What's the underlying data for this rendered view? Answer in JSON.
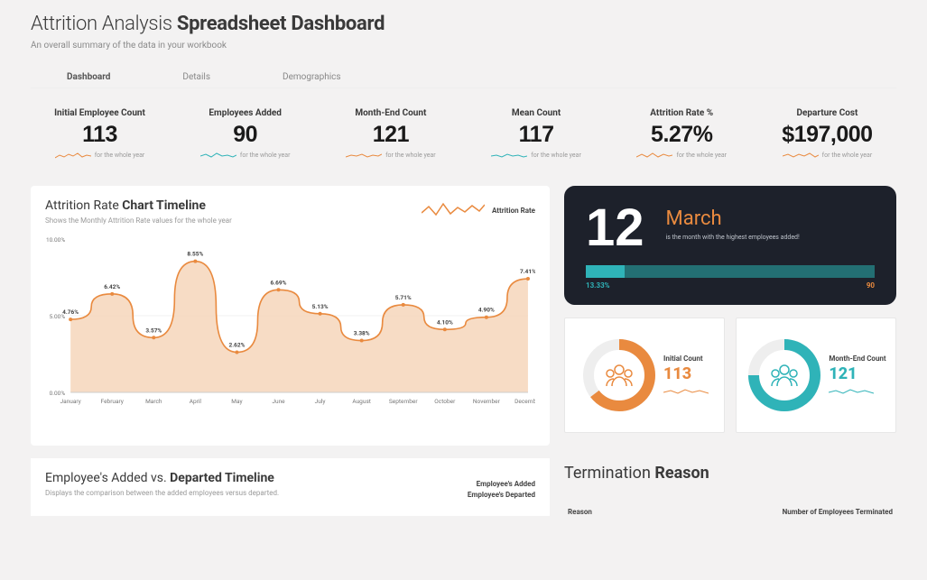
{
  "header": {
    "title_light": "Attrition Analysis",
    "title_bold": "Spreadsheet Dashboard",
    "subtitle": "An overall summary of the data in your workbook"
  },
  "tabs": [
    {
      "label": "Dashboard",
      "active": true
    },
    {
      "label": "Details",
      "active": false
    },
    {
      "label": "Demographics",
      "active": false
    }
  ],
  "kpis": [
    {
      "label": "Initial Employee Count",
      "value": "113",
      "footer": "for the whole year"
    },
    {
      "label": "Employees Added",
      "value": "90",
      "footer": "for the whole year"
    },
    {
      "label": "Month-End Count",
      "value": "121",
      "footer": "for the whole year"
    },
    {
      "label": "Mean Count",
      "value": "117",
      "footer": "for the whole year"
    },
    {
      "label": "Attrition Rate %",
      "value": "5.27%",
      "footer": "for the whole year"
    },
    {
      "label": "Departure Cost",
      "value": "$197,000",
      "footer": "for the whole year"
    }
  ],
  "area_card": {
    "title_light": "Attrition Rate",
    "title_bold": "Chart Timeline",
    "subtitle": "Shows the Monthly Attrition Rate values for the whole year",
    "legend": "Attrition Rate",
    "y_axis_top": "10.00%",
    "y_axis_mid": "5.00%",
    "y_axis_bot": "0.00%"
  },
  "highlight": {
    "number": "12",
    "month": "March",
    "desc": "is the month with the highest employees added!",
    "left_pct": "13.33%",
    "right_val": "90",
    "fill_pct": 13.33
  },
  "donuts": {
    "initial": {
      "label": "Initial Count",
      "value": "113"
    },
    "monthend": {
      "label": "Month-End Count",
      "value": "121"
    }
  },
  "timeline_card": {
    "title_light": "Employee's Added vs.",
    "title_bold": "Departed Timeline",
    "subtitle": "Displays the comparison between the added employees versus departed.",
    "legend1": "Employee's Added",
    "legend2": "Employee's Departed"
  },
  "termination": {
    "title_light": "Termination",
    "title_bold": "Reason",
    "col1": "Reason",
    "col2": "Number of Employees Terminated"
  },
  "chart_data": {
    "type": "area",
    "title": "Attrition Rate Chart Timeline",
    "xlabel": "",
    "ylabel": "%",
    "ylim": [
      0,
      10
    ],
    "categories": [
      "January",
      "February",
      "March",
      "April",
      "May",
      "June",
      "July",
      "August",
      "September",
      "October",
      "November",
      "December"
    ],
    "series": [
      {
        "name": "Attrition Rate",
        "values": [
          4.76,
          6.42,
          3.57,
          8.55,
          2.62,
          6.69,
          5.13,
          3.38,
          5.71,
          4.1,
          4.9,
          7.41
        ]
      }
    ]
  }
}
